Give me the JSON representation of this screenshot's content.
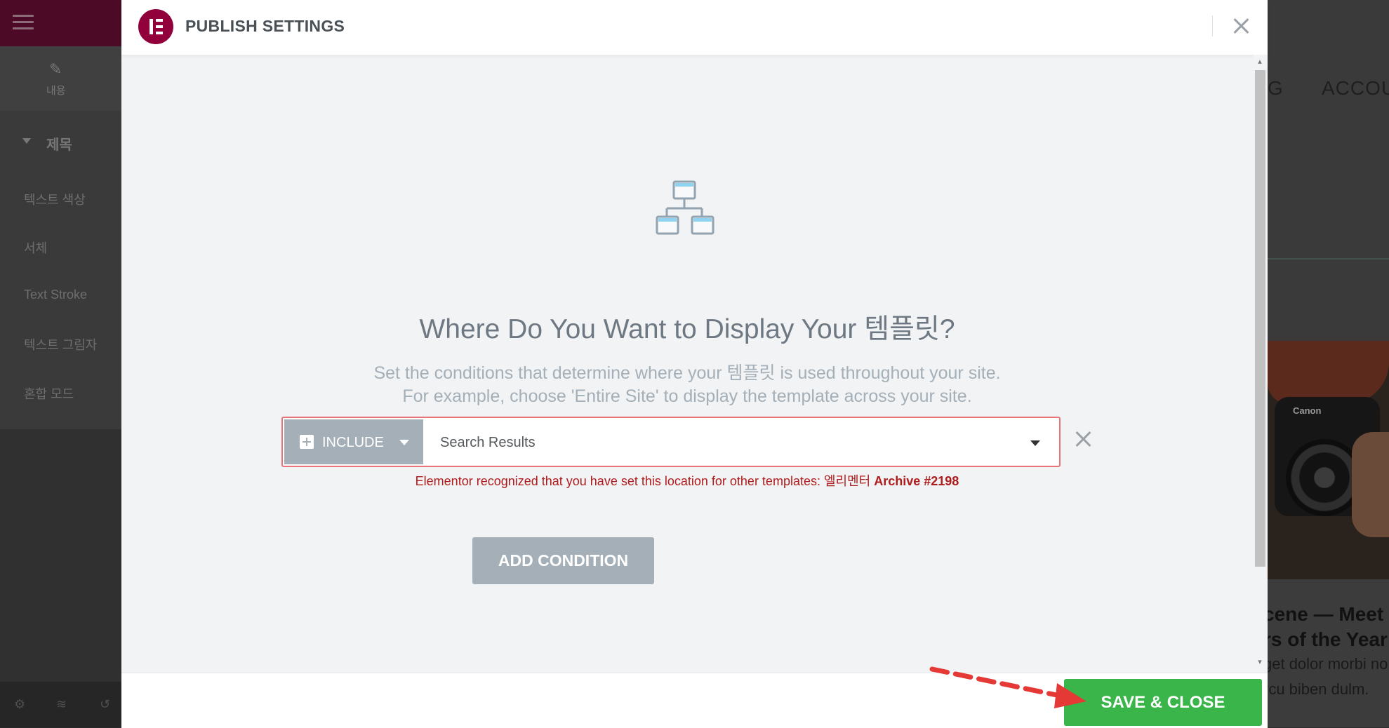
{
  "left_panel": {
    "tab_label": "내용",
    "section_title": "제목",
    "items": [
      "텍스트 색상",
      "서체",
      "Text Stroke",
      "텍스트 그림자",
      "혼합 모드"
    ]
  },
  "right_preview": {
    "nav_partial": [
      "G",
      "ACCOU"
    ],
    "headline_lines": [
      "cene — Meet",
      "rs of the Year"
    ],
    "body_lines": [
      "get dolor morbi no",
      "rcu biben dulm."
    ],
    "camera_brand": "Canon"
  },
  "modal": {
    "title": "PUBLISH SETTINGS",
    "headline": "Where Do You Want to Display Your 템플릿?",
    "subtitle_lines": [
      "Set the conditions that determine where your 템플릿 is used throughout your site.",
      "For example, choose 'Entire Site' to display the template across your site."
    ],
    "condition": {
      "type_label": "INCLUDE",
      "value": "Search Results"
    },
    "warning": {
      "text": "Elementor recognized that you have set this location for other templates: ",
      "template_name": "엘리멘터 ",
      "template_link": "Archive #2198"
    },
    "add_condition_label": "ADD CONDITION",
    "save_label": "SAVE & CLOSE"
  },
  "colors": {
    "brand": "#92003b",
    "save": "#39b54a",
    "warning": "#b01b1b",
    "muted_button": "#a4afb7",
    "annotation_arrow": "#e53935"
  }
}
